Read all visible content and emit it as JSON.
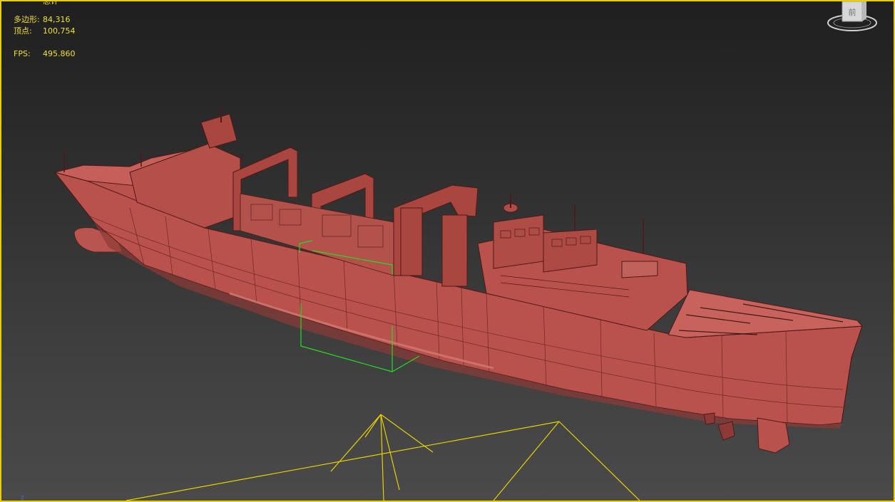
{
  "viewport": {
    "border_color": "#e8d000",
    "text_color": "#f2e030"
  },
  "stats": {
    "header": "总计",
    "polygons_label": "多边形:",
    "polygons_value": "84,316",
    "vertices_label": "顶点:",
    "vertices_value": "100,754",
    "fps_label": "FPS:",
    "fps_value": "495.860"
  },
  "viewcube": {
    "face_label": "前"
  },
  "axis": {
    "label": "z"
  },
  "scene": {
    "model_color": "#c8605a",
    "selection_color": "#22dd22",
    "camera_color": "#e8d000"
  }
}
